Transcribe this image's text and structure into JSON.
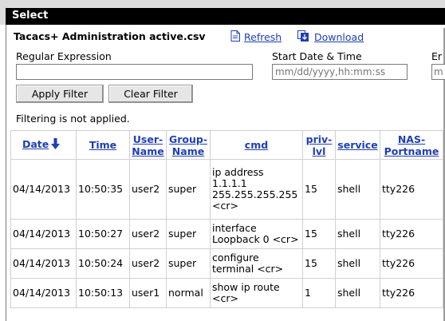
{
  "window": {
    "title": "Select"
  },
  "toolbar": {
    "file_title": "Tacacs+ Administration active.csv",
    "refresh_label": "Refresh",
    "download_label": "Download"
  },
  "filters": {
    "regex_label": "Regular Expression",
    "regex_value": "",
    "start_label": "Start Date & Time",
    "start_placeholder": "mm/dd/yyyy,hh:mm:ss",
    "end_label": "Er",
    "end_placeholder": "m",
    "apply_label": "Apply Filter",
    "clear_label": "Clear Filter",
    "status": "Filtering is not applied."
  },
  "table": {
    "headers": [
      [
        "Date"
      ],
      [
        "Time"
      ],
      [
        "User-",
        "Name"
      ],
      [
        "Group-",
        "Name"
      ],
      [
        "cmd"
      ],
      [
        "priv-",
        "lvl"
      ],
      [
        "service"
      ],
      [
        "NAS-",
        "Portname"
      ]
    ],
    "rows": [
      [
        "04/14/2013",
        "10:50:35",
        "user2",
        "super",
        [
          "ip address",
          "1.1.1.1",
          "255.255.255.255",
          "<cr>"
        ],
        "15",
        "shell",
        "tty226"
      ],
      [
        "04/14/2013",
        "10:50:27",
        "user2",
        "super",
        [
          "interface",
          "Loopback 0 <cr>"
        ],
        "15",
        "shell",
        "tty226"
      ],
      [
        "04/14/2013",
        "10:50:24",
        "user2",
        "super",
        [
          "configure",
          "terminal <cr>"
        ],
        "15",
        "shell",
        "tty226"
      ],
      [
        "04/14/2013",
        "10:50:13",
        "user1",
        "normal",
        [
          "show ip route",
          "<cr>"
        ],
        "1",
        "shell",
        "tty226"
      ]
    ]
  },
  "colors": {
    "link": "#1f3fb3",
    "titlebar": "#000000",
    "sort_arrow": "#1f3fb3"
  },
  "icons": {
    "refresh": "refresh-page-icon",
    "download": "download-icon",
    "sort": "sort-descending-arrow-icon"
  }
}
